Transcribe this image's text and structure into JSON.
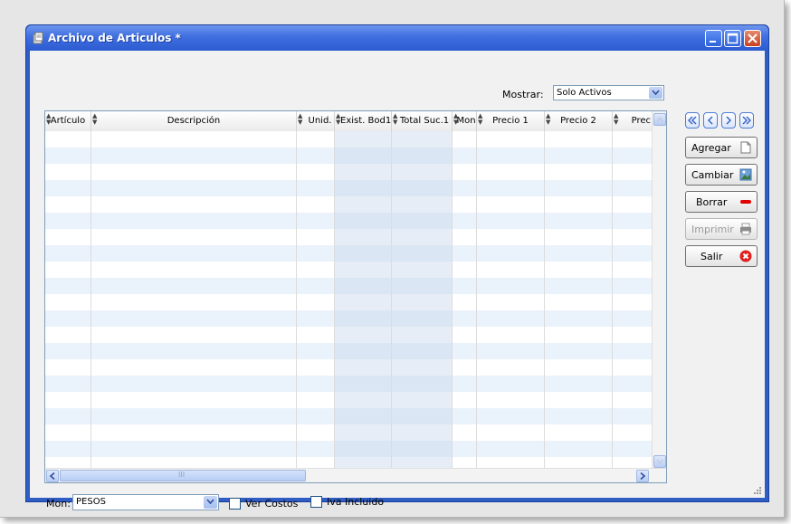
{
  "window": {
    "title": "Archivo de Articulos *",
    "icon": "app-document-icon"
  },
  "filter": {
    "mostrar_label": "Mostrar:",
    "mostrar_value": "Solo Activos"
  },
  "grid": {
    "columns": [
      {
        "label": "Artículo"
      },
      {
        "label": "Descripción"
      },
      {
        "label": "Unid."
      },
      {
        "label": "Exist. Bod1"
      },
      {
        "label": "Total Suc.1"
      },
      {
        "label": "Mon"
      },
      {
        "label": "Precio 1"
      },
      {
        "label": "Precio 2"
      },
      {
        "label": "Prec"
      }
    ],
    "rows": [],
    "scroll_thumb_marker": "III"
  },
  "nav": {
    "first_icon": "double-chevron-left-icon",
    "prev_icon": "chevron-left-icon",
    "next_icon": "chevron-right-icon",
    "last_icon": "double-chevron-right-icon"
  },
  "actions": {
    "agregar": "Agregar",
    "cambiar": "Cambiar",
    "borrar": "Borrar",
    "imprimir": "Imprimir",
    "salir": "Salir"
  },
  "footer": {
    "mon_label": "Mon:",
    "mon_value": "PESOS",
    "ver_costos": "Ver Costos",
    "iva_incluido": "Iva Incluido",
    "ver_costos_checked": false,
    "iva_incluido_checked": false
  },
  "colors": {
    "titlebar": "#3f6fe0",
    "row_stripe": "#eaf2fb",
    "borrar_icon": "#e00000",
    "salir_icon": "#e02020"
  }
}
